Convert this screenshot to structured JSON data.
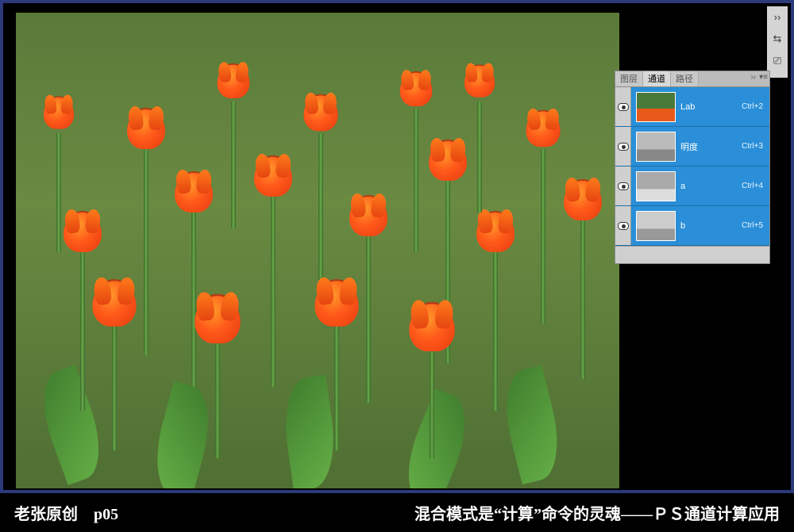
{
  "panel": {
    "tabs": {
      "layers": "图层",
      "channels": "通道",
      "paths": "路径"
    },
    "channels": [
      {
        "name": "Lab",
        "shortcut": "Ctrl+2",
        "thumb": "color"
      },
      {
        "name": "明度",
        "shortcut": "Ctrl+3",
        "thumb": "lightness"
      },
      {
        "name": "a",
        "shortcut": "Ctrl+4",
        "thumb": "a"
      },
      {
        "name": "b",
        "shortcut": "Ctrl+5",
        "thumb": "b"
      }
    ],
    "menu_icons": {
      "flyout": "››",
      "options": "▾≡"
    }
  },
  "toolbar": {
    "collapse_icon": "››",
    "tool_a": "⇆",
    "tool_b": "⎚"
  },
  "caption": {
    "left_author": "老张原创",
    "left_page": "p05",
    "right": "混合模式是“计算”命令的灵魂——ＰＳ通道计算应用"
  }
}
